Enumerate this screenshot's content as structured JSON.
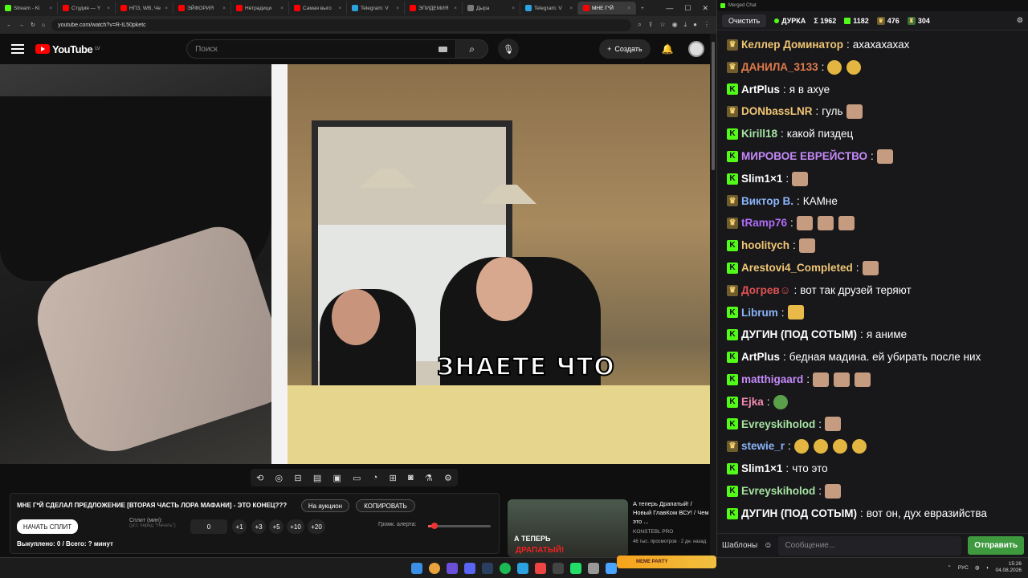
{
  "browser": {
    "tabs": [
      {
        "label": "Stream - Ki",
        "color": "#53fc18"
      },
      {
        "label": "Студия — Y",
        "color": "#ff0000"
      },
      {
        "label": "НПЗ, WB, Че",
        "color": "#ff0000"
      },
      {
        "label": "ЭЙФОРИЯ",
        "color": "#ff0000"
      },
      {
        "label": "Нетрадици",
        "color": "#ff0000"
      },
      {
        "label": "Самая выго",
        "color": "#ff0000"
      },
      {
        "label": "Telegram: V",
        "color": "#2aa3e0"
      },
      {
        "label": "ЭПИДЕМИЯ",
        "color": "#ff0000"
      },
      {
        "label": "Дыра",
        "color": "#7a7a7a"
      },
      {
        "label": "Telegram: V",
        "color": "#2aa3e0"
      },
      {
        "label": "МНЕ Г*Й",
        "color": "#ff0000",
        "active": true
      }
    ],
    "url": "youtube.com/watch?v=R-IL50pketc"
  },
  "youtube": {
    "logo_text": "YouTube",
    "region": "LV",
    "search_placeholder": "Поиск",
    "create_label": "Создать"
  },
  "video": {
    "caption": "ЗНАЕТЕ ЧТО"
  },
  "panel": {
    "title": "МНЕ Г*Й СДЕЛАЛ ПРЕДЛОЖЕНИЕ [ВТОРАЯ ЧАСТЬ ЛОРА МАФАНИ] - ЭТО КОНЕЦ???",
    "auction_label": "На аукцион",
    "copy_label": "КОПИРОВАТЬ",
    "start_split_label": "НАЧАТЬ СПЛИТ",
    "split_label": "Сплит (мин):",
    "split_hint": "(уст. перед \"Начать\")",
    "split_value": "0",
    "increments": [
      "+1",
      "+3",
      "+5",
      "+10",
      "+20"
    ],
    "volume_label": "Громк. алерта:",
    "volume_level": 0.1,
    "bought_text": "Выкуплено: 0 / Всего: ? минут"
  },
  "recommendation": {
    "thumb_line1": "А ТЕПЕРЬ",
    "thumb_line2": "ДРАПАТЫЙ!",
    "title": "А теперь Драпатый! / Новый ГлавКом ВСУ! / Чем это ...",
    "channel": "KONSTEBL PRO",
    "meta": "46 тыс. просмотров · 2 дн. назад"
  },
  "chat": {
    "window_title": "Merged Chat",
    "clear_label": "Очистить",
    "channel_name": "ДУРКА",
    "stats": {
      "total": "Σ 1962",
      "kick": "1182",
      "twitch": "476",
      "other": "304"
    },
    "messages": [
      {
        "platform": "tw",
        "user": "Келлер Доминатор",
        "color": "#f0c674",
        "text": "ахахахахах",
        "emotes": []
      },
      {
        "platform": "tw",
        "user": "ДАНИЛА_3133",
        "color": "#e07b4a",
        "text": "",
        "emotes": [
          "laugh",
          "laugh"
        ]
      },
      {
        "platform": "k",
        "user": "ArtPlus",
        "color": "#ffffff",
        "text": "я в ахуе",
        "emotes": []
      },
      {
        "platform": "tw",
        "user": "DONbassLNR",
        "color": "#f0c674",
        "text": "гуль",
        "emotes": [
          "face"
        ]
      },
      {
        "platform": "k",
        "user": "Kirill18",
        "color": "#a6e3a1",
        "text": "какой пиздец",
        "emotes": []
      },
      {
        "platform": "k",
        "user": "МИРОВОЕ ЕВРЕЙСТВО",
        "color": "#c58af9",
        "text": "",
        "emotes": [
          "face"
        ]
      },
      {
        "platform": "k",
        "user": "Slim1×1",
        "color": "#ffffff",
        "text": "",
        "emotes": [
          "face"
        ]
      },
      {
        "platform": "tw",
        "user": "Виктор В.",
        "color": "#8ab4f8",
        "text": "КАМне",
        "emotes": []
      },
      {
        "platform": "tw",
        "user": "tRamp76",
        "color": "#b16cf7",
        "text": "",
        "emotes": [
          "face",
          "face",
          "face"
        ]
      },
      {
        "platform": "k",
        "user": "hoolitych",
        "color": "#f0c674",
        "text": "",
        "emotes": [
          "face"
        ]
      },
      {
        "platform": "k",
        "user": "Arestovi4_Completed",
        "color": "#f0c674",
        "text": "",
        "emotes": [
          "face"
        ]
      },
      {
        "platform": "tw",
        "user": "Догрев☺",
        "color": "#e05252",
        "text": "вот так друзей теряют",
        "emotes": []
      },
      {
        "platform": "k",
        "user": "Librum",
        "color": "#8ab4f8",
        "text": "",
        "emotes": [
          "hand"
        ]
      },
      {
        "platform": "k",
        "user": "ДУГИН (ПОД СОТЫМ)",
        "color": "#ffffff",
        "text": "я аниме",
        "emotes": []
      },
      {
        "platform": "k",
        "user": "ArtPlus",
        "color": "#ffffff",
        "text": "бедная мадина. ей убирать после них",
        "emotes": []
      },
      {
        "platform": "k",
        "user": "matthigaard",
        "color": "#c58af9",
        "text": "",
        "emotes": [
          "face",
          "face",
          "face"
        ]
      },
      {
        "platform": "k",
        "user": "Ejka",
        "color": "#f28cb1",
        "text": "",
        "emotes": [
          "frog"
        ]
      },
      {
        "platform": "k",
        "user": "Evreyskiholod",
        "color": "#a6e3a1",
        "text": "",
        "emotes": [
          "face"
        ]
      },
      {
        "platform": "tw",
        "user": "stewie_r",
        "color": "#8ab4f8",
        "text": "",
        "emotes": [
          "laugh",
          "laugh",
          "laugh",
          "laugh"
        ]
      },
      {
        "platform": "k",
        "user": "Slim1×1",
        "color": "#ffffff",
        "text": "что это",
        "emotes": []
      },
      {
        "platform": "k",
        "user": "Evreyskiholod",
        "color": "#a6e3a1",
        "text": "",
        "emotes": [
          "face"
        ]
      },
      {
        "platform": "k",
        "user": "ДУГИН (ПОД СОТЫМ)",
        "color": "#ffffff",
        "text": "вот он, дух евразийства",
        "emotes": []
      }
    ],
    "templates_label": "Шаблоны",
    "input_placeholder": "Сообщение...",
    "send_label": "Отправить"
  },
  "taskbar": {
    "stream_widget": "MEME PARTY",
    "lang": "РУС",
    "time": "15:26",
    "date": "04.08.2026"
  },
  "colors": {
    "kick": "#53fc18",
    "youtube_red": "#ff0000",
    "send_green": "#3f9a3f"
  }
}
